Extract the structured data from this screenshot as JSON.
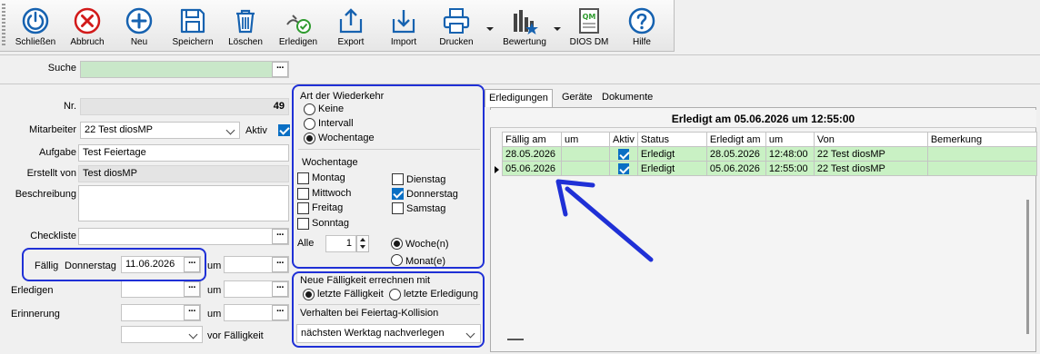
{
  "toolbar": {
    "buttons": [
      {
        "label": "Schließen",
        "icon": "power-icon"
      },
      {
        "label": "Abbruch",
        "icon": "cancel-icon"
      },
      {
        "label": "Neu",
        "icon": "plus-icon"
      },
      {
        "label": "Speichern",
        "icon": "save-icon"
      },
      {
        "label": "Löschen",
        "icon": "trash-icon"
      },
      {
        "label": "Erledigen",
        "icon": "done-icon"
      },
      {
        "label": "Export",
        "icon": "export-icon"
      },
      {
        "label": "Import",
        "icon": "import-icon"
      },
      {
        "label": "Drucken",
        "icon": "printer-icon"
      },
      {
        "label": "Bewertung",
        "icon": "chart-icon"
      },
      {
        "label": "DIOS DM",
        "icon": "qm-icon"
      },
      {
        "label": "Hilfe",
        "icon": "help-icon"
      }
    ]
  },
  "search": {
    "label": "Suche",
    "value": ""
  },
  "form": {
    "nr_label": "Nr.",
    "nr_value": "49",
    "mitarbeiter_label": "Mitarbeiter",
    "mitarbeiter_value": "22   Test diosMP",
    "aktiv_label": "Aktiv",
    "aufgabe_label": "Aufgabe",
    "aufgabe_value": "Test Feiertage",
    "erstellt_label": "Erstellt von",
    "erstellt_value": "Test diosMP",
    "beschreibung_label": "Beschreibung",
    "checkliste_label": "Checkliste",
    "faellig_label": "Fällig",
    "faellig_weekday": "Donnerstag",
    "faellig_date": "11.06.2026",
    "um_label": "um",
    "erledigen_label": "Erledigen",
    "erinnerung_label": "Erinnerung",
    "vor_faelligkeit_label": "vor Fälligkeit"
  },
  "recurrence": {
    "title": "Art der Wiederkehr",
    "options": [
      "Keine",
      "Intervall",
      "Wochentage"
    ],
    "selected": "Wochentage",
    "weekdays_title": "Wochentage",
    "weekdays": [
      {
        "label": "Montag",
        "checked": false
      },
      {
        "label": "Dienstag",
        "checked": false
      },
      {
        "label": "Mittwoch",
        "checked": false
      },
      {
        "label": "Donnerstag",
        "checked": true
      },
      {
        "label": "Freitag",
        "checked": false
      },
      {
        "label": "Samstag",
        "checked": false
      },
      {
        "label": "Sonntag",
        "checked": false
      }
    ],
    "alle_label": "Alle",
    "alle_value": "1",
    "unit_week": "Woche(n)",
    "unit_month": "Monat(e)",
    "unit_selected": "Woche(n)"
  },
  "recalc": {
    "title": "Neue Fälligkeit errechnen mit",
    "opt_last_due": "letzte Fälligkeit",
    "opt_last_done": "letzte Erledigung",
    "selected": "letzte Fälligkeit",
    "holiday_title": "Verhalten bei Feiertag-Kollision",
    "holiday_value": "nächsten Werktag nachverlegen"
  },
  "tabs": [
    "Erledigungen",
    "Geräte",
    "Dokumente"
  ],
  "grid": {
    "title": "Erledigt am 05.06.2026 um 12:55:00",
    "columns": [
      "Fällig am",
      "um",
      "Aktiv",
      "Status",
      "Erledigt am",
      "um",
      "Von",
      "Bemerkung"
    ],
    "rows": [
      {
        "faellig": "28.05.2026",
        "um": "",
        "aktiv": true,
        "status": "Erledigt",
        "erledigt": "28.05.2026",
        "um2": "12:48:00",
        "von": "22   Test diosMP",
        "bemerkung": ""
      },
      {
        "faellig": "05.06.2026",
        "um": "",
        "aktiv": true,
        "status": "Erledigt",
        "erledigt": "05.06.2026",
        "um2": "12:55:00",
        "von": "22   Test diosMP",
        "bemerkung": ""
      }
    ]
  },
  "colors": {
    "accent": "#1f30d6",
    "row_green": "#c9f1c4",
    "check_blue": "#0a6fc4"
  }
}
